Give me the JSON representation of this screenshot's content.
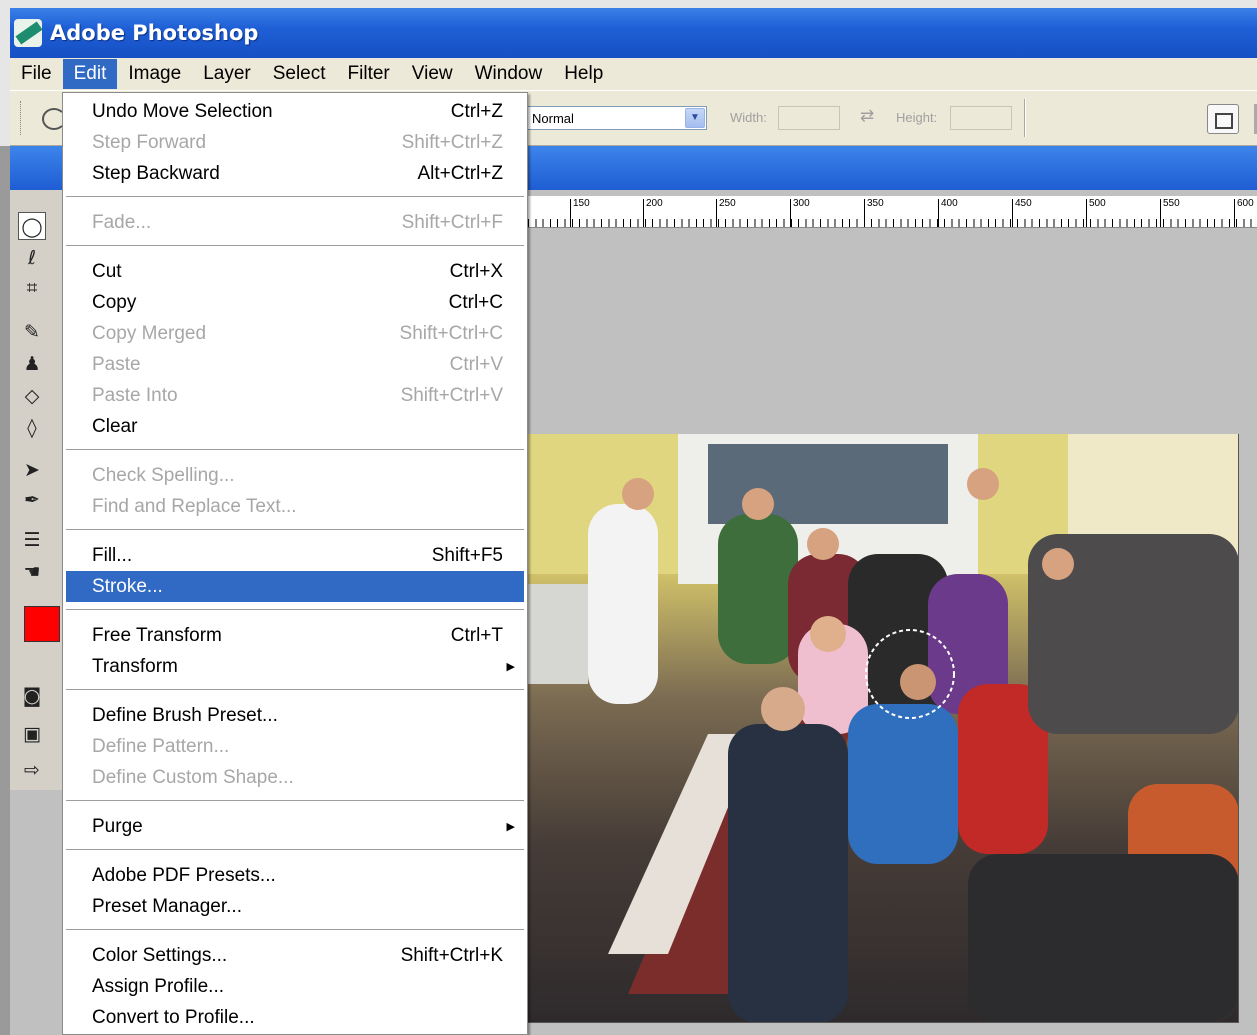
{
  "app": {
    "title": "Adobe Photoshop"
  },
  "menubar": [
    "File",
    "Edit",
    "Image",
    "Layer",
    "Select",
    "Filter",
    "View",
    "Window",
    "Help"
  ],
  "options": {
    "style_value": "Normal",
    "width_label": "Width:",
    "height_label": "Height:"
  },
  "ruler": [
    "150",
    "200",
    "250",
    "300",
    "350",
    "400",
    "450",
    "500",
    "550",
    "600"
  ],
  "edit_menu": {
    "undo": {
      "label": "Undo Move Selection",
      "shortcut": "Ctrl+Z"
    },
    "step_forward": {
      "label": "Step Forward",
      "shortcut": "Shift+Ctrl+Z"
    },
    "step_backward": {
      "label": "Step Backward",
      "shortcut": "Alt+Ctrl+Z"
    },
    "fade": {
      "label": "Fade...",
      "shortcut": "Shift+Ctrl+F"
    },
    "cut": {
      "label": "Cut",
      "shortcut": "Ctrl+X"
    },
    "copy": {
      "label": "Copy",
      "shortcut": "Ctrl+C"
    },
    "copy_merged": {
      "label": "Copy Merged",
      "shortcut": "Shift+Ctrl+C"
    },
    "paste": {
      "label": "Paste",
      "shortcut": "Ctrl+V"
    },
    "paste_into": {
      "label": "Paste Into",
      "shortcut": "Shift+Ctrl+V"
    },
    "clear": {
      "label": "Clear"
    },
    "check_spelling": {
      "label": "Check Spelling..."
    },
    "find_replace": {
      "label": "Find and Replace Text..."
    },
    "fill": {
      "label": "Fill...",
      "shortcut": "Shift+F5"
    },
    "stroke": {
      "label": "Stroke..."
    },
    "free_transform": {
      "label": "Free Transform",
      "shortcut": "Ctrl+T"
    },
    "transform": {
      "label": "Transform"
    },
    "define_brush": {
      "label": "Define Brush Preset..."
    },
    "define_pattern": {
      "label": "Define Pattern..."
    },
    "define_shape": {
      "label": "Define Custom Shape..."
    },
    "purge": {
      "label": "Purge"
    },
    "pdf_presets": {
      "label": "Adobe PDF Presets..."
    },
    "preset_manager": {
      "label": "Preset Manager..."
    },
    "color_settings": {
      "label": "Color Settings...",
      "shortcut": "Shift+Ctrl+K"
    },
    "assign_profile": {
      "label": "Assign Profile..."
    },
    "convert_profile": {
      "label": "Convert to Profile..."
    }
  },
  "colors": {
    "title_bar": "#1f5fd6",
    "menu_highlight": "#316ac5",
    "foreground_color": "#ff0000",
    "background_color": "#ffffff"
  }
}
